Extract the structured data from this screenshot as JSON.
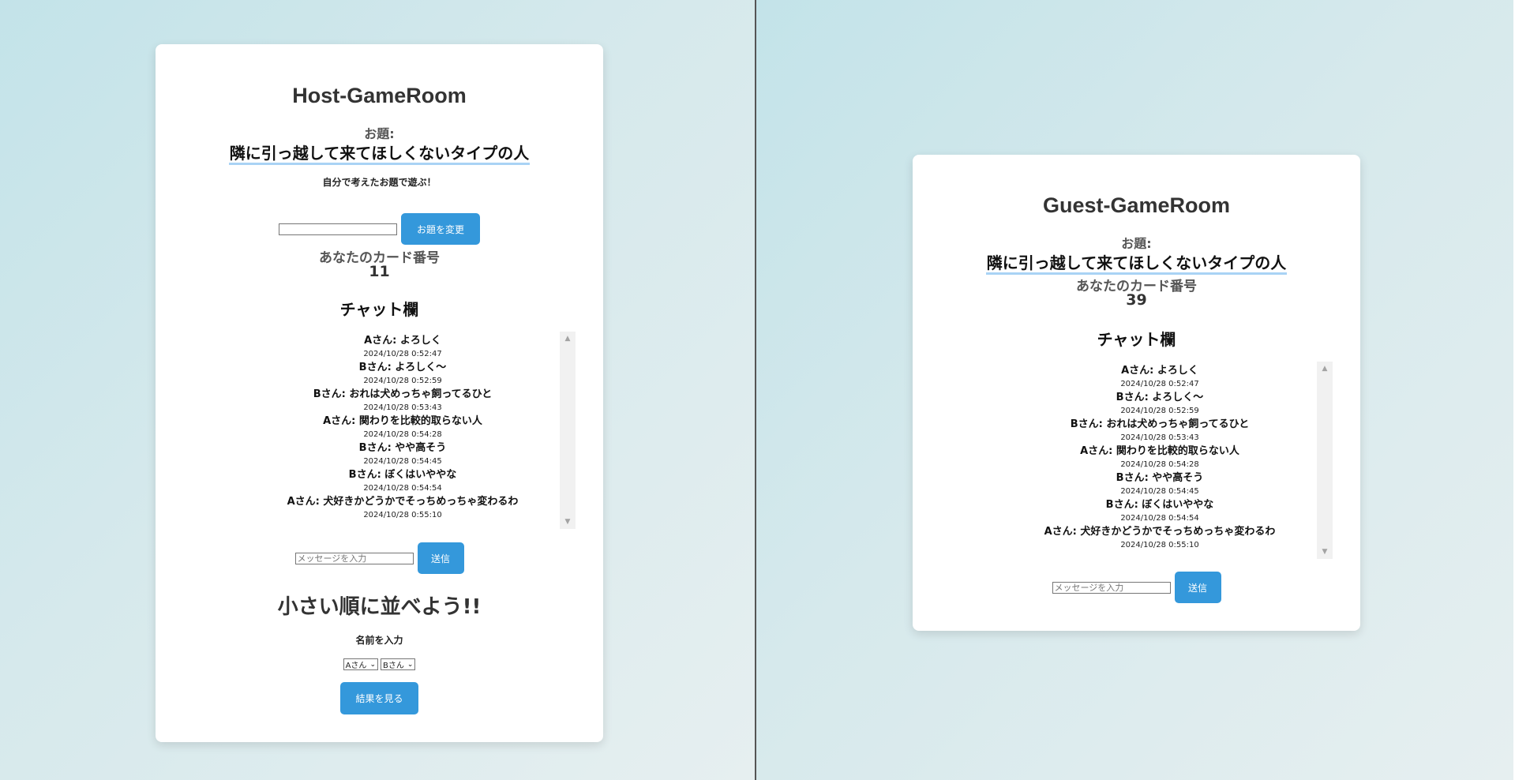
{
  "host": {
    "title": "Host-GameRoom",
    "topic_label": "お題:",
    "topic": "隣に引っ越して来てほしくないタイプの人",
    "own_topic_note": "自分で考えたお題で遊ぶ！",
    "change_topic_button": "お題を変更",
    "card_label": "あなたのカード番号",
    "card_number": "11",
    "chat_title": "チャット欄",
    "chat_placeholder": "メッセージを入力",
    "send_button": "送信",
    "sort_title": "小さい順に並べよう!!",
    "name_label": "名前を入力",
    "select_values": [
      "Aさん",
      "Bさん"
    ],
    "result_button": "結果を見る"
  },
  "guest": {
    "title": "Guest-GameRoom",
    "topic_label": "お題:",
    "topic": "隣に引っ越して来てほしくないタイプの人",
    "card_label": "あなたのカード番号",
    "card_number": "39",
    "chat_title": "チャット欄",
    "chat_placeholder": "メッセージを入力",
    "send_button": "送信"
  },
  "messages": [
    {
      "text": "Aさん: よろしく",
      "time": "2024/10/28 0:52:47"
    },
    {
      "text": "Bさん: よろしく〜",
      "time": "2024/10/28 0:52:59"
    },
    {
      "text": "Bさん: おれは犬めっちゃ飼ってるひと",
      "time": "2024/10/28 0:53:43"
    },
    {
      "text": "Aさん: 関わりを比較的取らない人",
      "time": "2024/10/28 0:54:28"
    },
    {
      "text": "Bさん: やや高そう",
      "time": "2024/10/28 0:54:45"
    },
    {
      "text": "Bさん: ぼくはいややな",
      "time": "2024/10/28 0:54:54"
    },
    {
      "text": "Aさん: 犬好きかどうかでそっちめっちゃ変わるわ",
      "time": "2024/10/28 0:55:10"
    }
  ],
  "colors": {
    "accent": "#3498db",
    "topic_underline": "#a9d3f5"
  }
}
